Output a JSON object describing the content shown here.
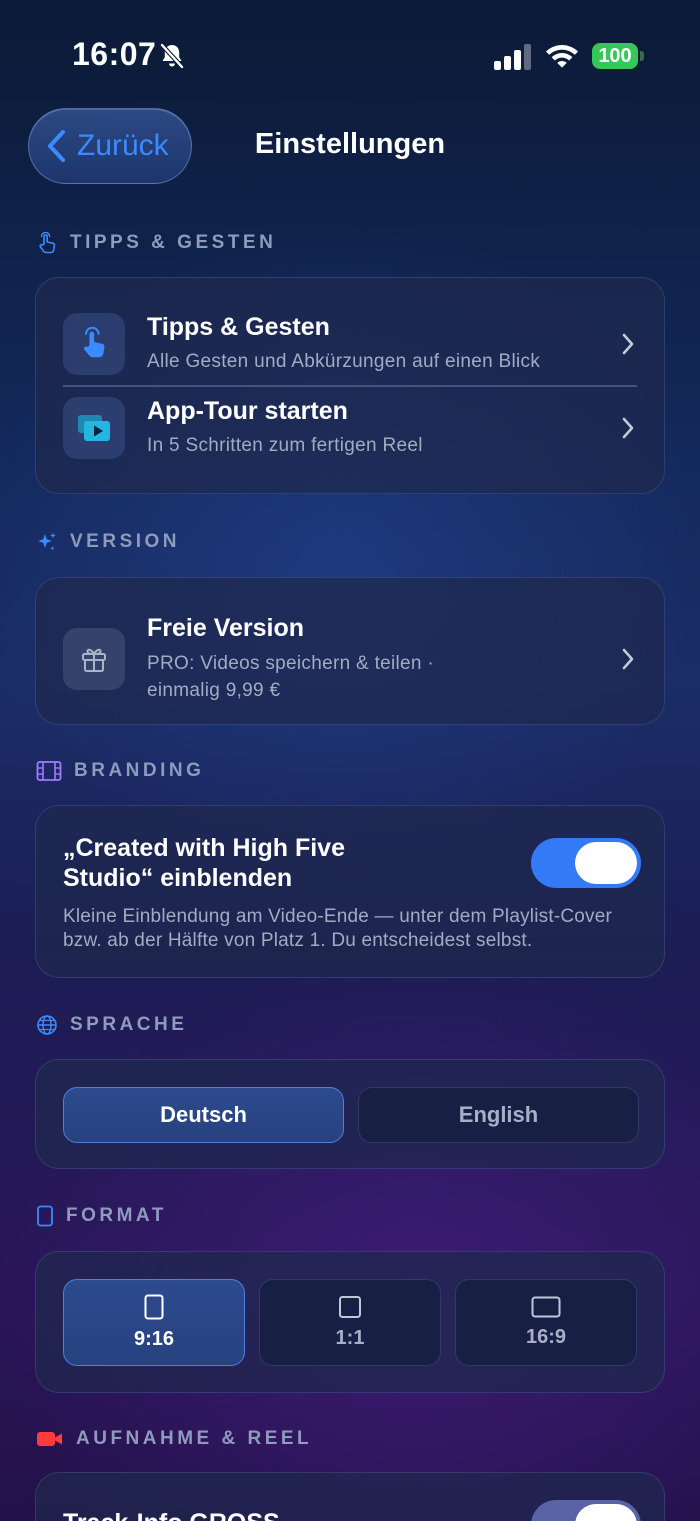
{
  "status": {
    "time": "16:07",
    "battery": "100"
  },
  "nav": {
    "back_label": "Zurück",
    "title": "Einstellungen"
  },
  "sections": {
    "tips": {
      "header": "TIPPS & GESTEN",
      "items": [
        {
          "title": "Tipps & Gesten",
          "subtitle": "Alle Gesten und Abkürzungen auf einen Blick"
        },
        {
          "title": "App-Tour starten",
          "subtitle": "In 5 Schritten zum fertigen Reel"
        }
      ]
    },
    "version": {
      "header": "VERSION",
      "title": "Freie Version",
      "subtitle_line1": "PRO: Videos speichern & teilen ·",
      "subtitle_line2": "einmalig 9,99 €"
    },
    "branding": {
      "header": "BRANDING",
      "title_line1": "„Created with High Five",
      "title_line2": "Studio“ einblenden",
      "desc_line1": "Kleine Einblendung am Video-Ende — unter dem Playlist-Cover",
      "desc_line2": "bzw. ab der Hälfte von Platz 1. Du entscheidest selbst.",
      "enabled": true
    },
    "language": {
      "header": "SPRACHE",
      "options": [
        "Deutsch",
        "English"
      ],
      "selected": "Deutsch"
    },
    "format": {
      "header": "FORMAT",
      "options": [
        "9:16",
        "1:1",
        "16:9"
      ],
      "selected": "9:16"
    },
    "recording": {
      "header": "AUFNAHME & REEL",
      "first_item": "Track-Info GROSS"
    }
  },
  "colors": {
    "accent": "#3479f6",
    "link": "#3b8bff",
    "battery": "#34c759",
    "record": "#ff3b3b",
    "branding_icon": "#a07cff"
  }
}
